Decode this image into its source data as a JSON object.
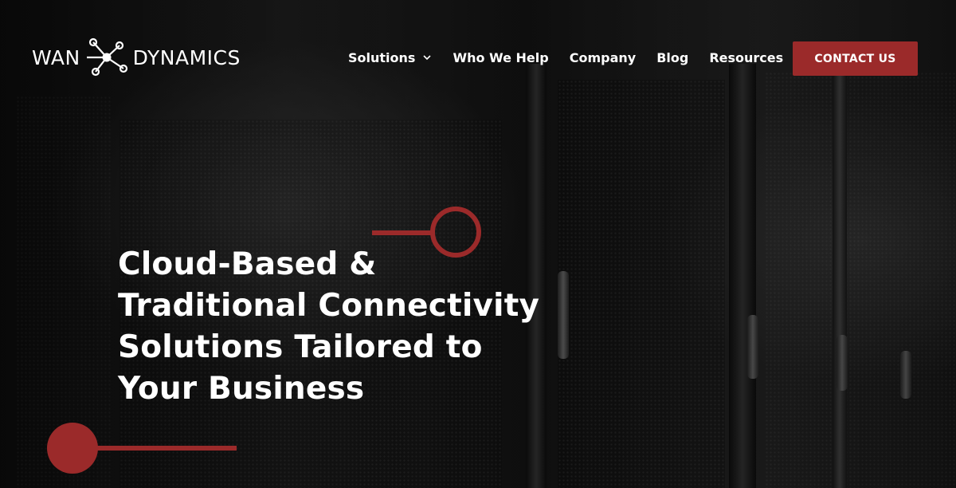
{
  "brand": {
    "left_word": "WAN",
    "right_word": "DYNAMICS",
    "accent_color": "#9b2a2a"
  },
  "nav": {
    "items": [
      {
        "label": "Solutions",
        "has_dropdown": true
      },
      {
        "label": "Who We Help"
      },
      {
        "label": "Company"
      },
      {
        "label": "Blog"
      },
      {
        "label": "Resources"
      }
    ],
    "contact_label": "CONTACT US"
  },
  "hero": {
    "headline_lines": [
      "Cloud-Based &",
      "Traditional Connectivity",
      "Solutions Tailored to",
      "Your Business"
    ]
  },
  "icons": {
    "logo": "network-node-icon",
    "dropdown": "chevron-down-icon"
  }
}
